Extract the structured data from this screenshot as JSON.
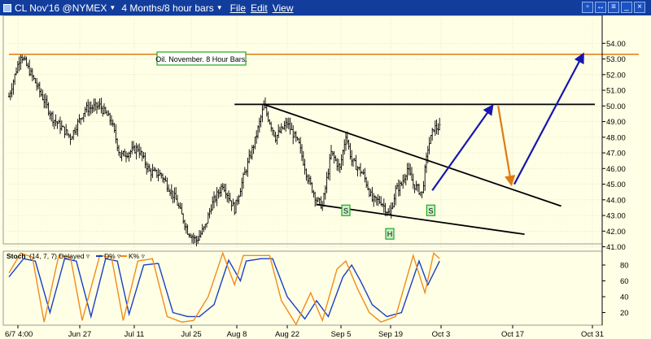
{
  "window": {
    "title_symbol": "CL Nov'16 @NYMEX",
    "title_period": "4 Months/8 hour bars",
    "menus": [
      "File",
      "Edit",
      "View"
    ]
  },
  "annotations": {
    "label_box": "Oil. November. 8 Hour Bars.",
    "markers": [
      "S",
      "S",
      "H"
    ]
  },
  "stoch_legend": {
    "title": "Stoch",
    "params": "(14, 7, 7) Delayed",
    "d_label": "D%",
    "k_label": "K%"
  },
  "colors": {
    "background": "#ffffe6",
    "titlebar": "#123d9c",
    "resistance_line": "#e07a10",
    "projection_blue": "#1616b0",
    "projection_orange": "#e07a10",
    "trendline": "#000000",
    "stoch_d": "#1a3fc4",
    "stoch_k": "#f08c1a",
    "marker_border": "#1fa81f"
  },
  "chart_data": [
    {
      "type": "ohlc",
      "x_tick_labels": [
        "6/7 4:00",
        "Jun 27",
        "Jul 11",
        "Jul 25",
        "Aug 8",
        "Aug 22",
        "Sep 5",
        "Sep 19",
        "Oct 3",
        "Oct 17",
        "Oct 31"
      ],
      "y_tick_labels": [
        "41.00",
        "42.00",
        "43.00",
        "44.00",
        "45.00",
        "46.00",
        "47.00",
        "48.00",
        "49.00",
        "50.00",
        "51.00",
        "52.00",
        "53.00",
        "54.00"
      ],
      "ylim": [
        40.5,
        54.5
      ],
      "close_anchors": [
        [
          0,
          50.6
        ],
        [
          8,
          53.3
        ],
        [
          18,
          51.5
        ],
        [
          30,
          49.2
        ],
        [
          42,
          48.0
        ],
        [
          52,
          49.8
        ],
        [
          62,
          50.0
        ],
        [
          70,
          49.0
        ],
        [
          76,
          46.8
        ],
        [
          88,
          47.3
        ],
        [
          96,
          45.8
        ],
        [
          104,
          45.6
        ],
        [
          114,
          44.0
        ],
        [
          122,
          42.0
        ],
        [
          128,
          41.4
        ],
        [
          134,
          42.3
        ],
        [
          138,
          43.6
        ],
        [
          146,
          45.0
        ],
        [
          154,
          43.4
        ],
        [
          160,
          45.4
        ],
        [
          168,
          47.8
        ],
        [
          174,
          50.0
        ],
        [
          182,
          48.0
        ],
        [
          190,
          48.9
        ],
        [
          198,
          47.5
        ],
        [
          204,
          45.4
        ],
        [
          210,
          44.0
        ],
        [
          214,
          43.6
        ],
        [
          220,
          47.0
        ],
        [
          226,
          46.0
        ],
        [
          230,
          48.2
        ],
        [
          234,
          46.5
        ],
        [
          242,
          45.6
        ],
        [
          248,
          44.0
        ],
        [
          254,
          43.9
        ],
        [
          260,
          43.0
        ],
        [
          264,
          44.6
        ],
        [
          268,
          45.0
        ],
        [
          272,
          46.0
        ],
        [
          276,
          45.0
        ],
        [
          282,
          44.4
        ],
        [
          286,
          47.3
        ],
        [
          290,
          48.6
        ],
        [
          294,
          48.6
        ]
      ],
      "last_bar_index": 294,
      "lines": [
        {
          "name": "resistance-line",
          "from": [
            0,
            53.3
          ],
          "to": [
            430,
            53.3
          ],
          "color": "orange"
        },
        {
          "name": "top-horizontal-line",
          "from": [
            154,
            50.1
          ],
          "to": [
            400,
            50.1
          ],
          "color": "black"
        },
        {
          "name": "upper-wedge-line",
          "from": [
            174,
            50.1
          ],
          "to": [
            377,
            43.6
          ],
          "color": "black"
        },
        {
          "name": "lower-wedge-line",
          "from": [
            210,
            43.7
          ],
          "to": [
            352,
            41.8
          ],
          "color": "black"
        }
      ],
      "projections": [
        {
          "name": "projection-up-1",
          "from": [
            289,
            44.6
          ],
          "to": [
            330,
            50.0
          ],
          "color": "blue"
        },
        {
          "name": "projection-down",
          "from": [
            334,
            50.0
          ],
          "to": [
            343,
            45.0
          ],
          "color": "orange"
        },
        {
          "name": "projection-up-2",
          "from": [
            345,
            45.0
          ],
          "to": [
            392,
            53.3
          ],
          "color": "blue"
        }
      ],
      "markers": [
        {
          "label": "S",
          "x": 230,
          "y": 43.3
        },
        {
          "label": "S",
          "x": 288,
          "y": 43.3
        },
        {
          "label": "H",
          "x": 260,
          "y": 41.8
        }
      ]
    },
    {
      "type": "line",
      "title": "Stoch (14, 7, 7) Delayed",
      "y_tick_labels": [
        "20",
        "40",
        "60",
        "80"
      ],
      "ylim": [
        5,
        95
      ],
      "series": [
        {
          "name": "D%",
          "anchors": [
            [
              0,
              65
            ],
            [
              10,
              88
            ],
            [
              18,
              85
            ],
            [
              28,
              20
            ],
            [
              38,
              88
            ],
            [
              46,
              85
            ],
            [
              56,
              15
            ],
            [
              66,
              88
            ],
            [
              74,
              85
            ],
            [
              82,
              18
            ],
            [
              92,
              80
            ],
            [
              102,
              82
            ],
            [
              112,
              20
            ],
            [
              122,
              15
            ],
            [
              130,
              15
            ],
            [
              140,
              30
            ],
            [
              150,
              86
            ],
            [
              158,
              60
            ],
            [
              162,
              85
            ],
            [
              172,
              88
            ],
            [
              180,
              88
            ],
            [
              190,
              40
            ],
            [
              202,
              12
            ],
            [
              210,
              35
            ],
            [
              218,
              15
            ],
            [
              228,
              65
            ],
            [
              234,
              80
            ],
            [
              240,
              60
            ],
            [
              248,
              30
            ],
            [
              258,
              15
            ],
            [
              268,
              20
            ],
            [
              280,
              85
            ],
            [
              286,
              55
            ],
            [
              294,
              85
            ]
          ]
        },
        {
          "name": "K%",
          "anchors": [
            [
              0,
              70
            ],
            [
              8,
              95
            ],
            [
              16,
              90
            ],
            [
              24,
              8
            ],
            [
              34,
              92
            ],
            [
              42,
              90
            ],
            [
              50,
              10
            ],
            [
              62,
              92
            ],
            [
              70,
              90
            ],
            [
              78,
              10
            ],
            [
              88,
              85
            ],
            [
              98,
              88
            ],
            [
              108,
              15
            ],
            [
              118,
              8
            ],
            [
              126,
              10
            ],
            [
              136,
              40
            ],
            [
              146,
              95
            ],
            [
              154,
              55
            ],
            [
              160,
              92
            ],
            [
              170,
              92
            ],
            [
              178,
              92
            ],
            [
              186,
              35
            ],
            [
              196,
              5
            ],
            [
              206,
              45
            ],
            [
              214,
              10
            ],
            [
              224,
              75
            ],
            [
              230,
              85
            ],
            [
              238,
              50
            ],
            [
              246,
              20
            ],
            [
              254,
              8
            ],
            [
              264,
              15
            ],
            [
              276,
              92
            ],
            [
              284,
              45
            ],
            [
              290,
              95
            ],
            [
              294,
              88
            ]
          ]
        }
      ]
    }
  ]
}
